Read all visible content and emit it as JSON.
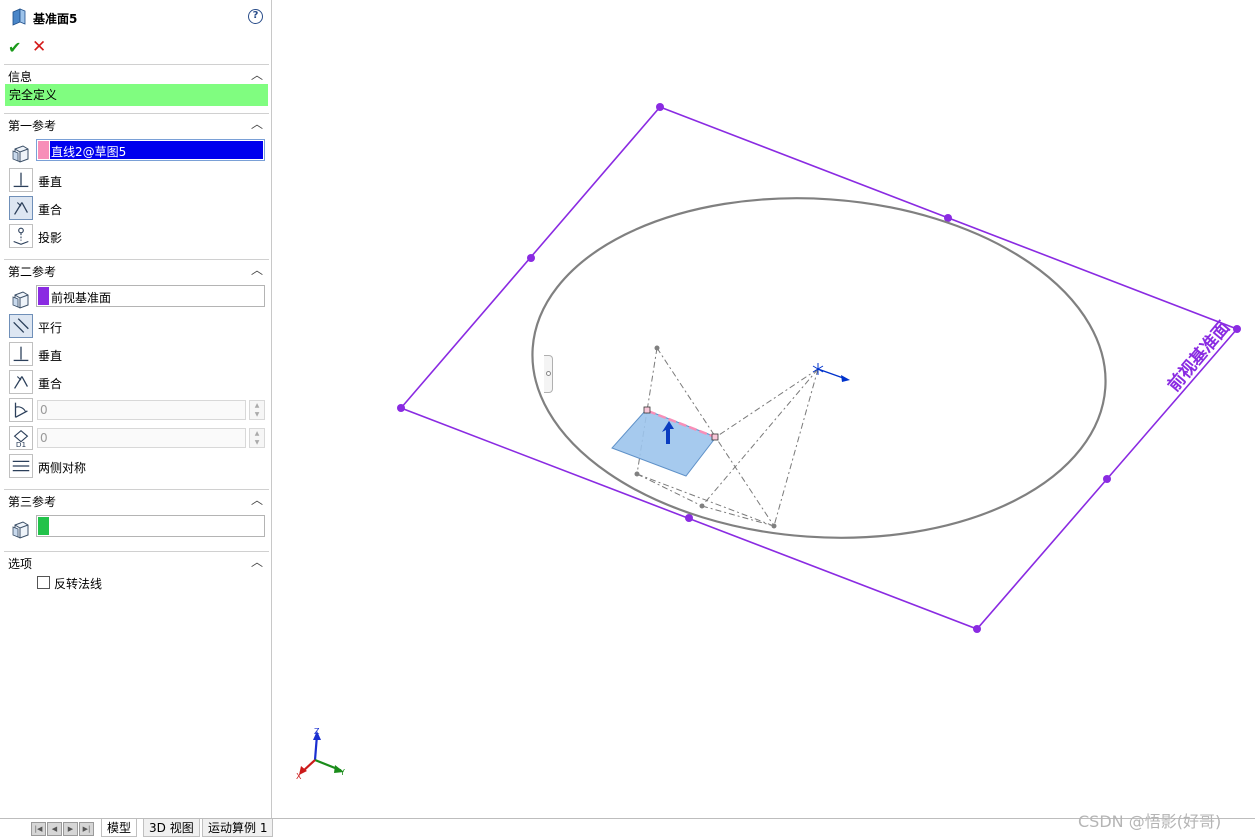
{
  "property_manager": {
    "title": "基准面5",
    "help_icon": "help-icon",
    "ok_icon": "check-icon",
    "cancel_icon": "close-icon",
    "sections": {
      "info": {
        "label": "信息",
        "status": "完全定义",
        "status_color": "#80fd80"
      },
      "first_ref": {
        "label": "第一参考",
        "selection": "直线2@草图5",
        "swatch_color": "#f78fb8",
        "options": [
          "垂直",
          "重合",
          "投影"
        ]
      },
      "second_ref": {
        "label": "第二参考",
        "selection": "前视基准面",
        "swatch_color": "#8a2be2",
        "options": [
          "平行",
          "垂直",
          "重合"
        ],
        "angle_value": "0",
        "distance_value": "0",
        "symmetric_label": "两侧对称"
      },
      "third_ref": {
        "label": "第三参考",
        "selection": "",
        "swatch_color": "#22c24a"
      },
      "options": {
        "label": "选项",
        "flip_normal_label": "反转法线",
        "flip_normal_checked": false
      }
    },
    "chevron": "^"
  },
  "viewport": {
    "plane_label": "前视基准面",
    "plane_color": "#8a2be2",
    "ellipse_color": "#808080",
    "axis_labels": {
      "x": "X",
      "y": "Y",
      "z": "Z"
    }
  },
  "tabs": [
    "模型",
    "3D 视图",
    "运动算例 1"
  ],
  "nav_buttons": [
    "|◀",
    "◀",
    "▶",
    "▶|"
  ],
  "watermark": "CSDN @悟影(好哥)"
}
